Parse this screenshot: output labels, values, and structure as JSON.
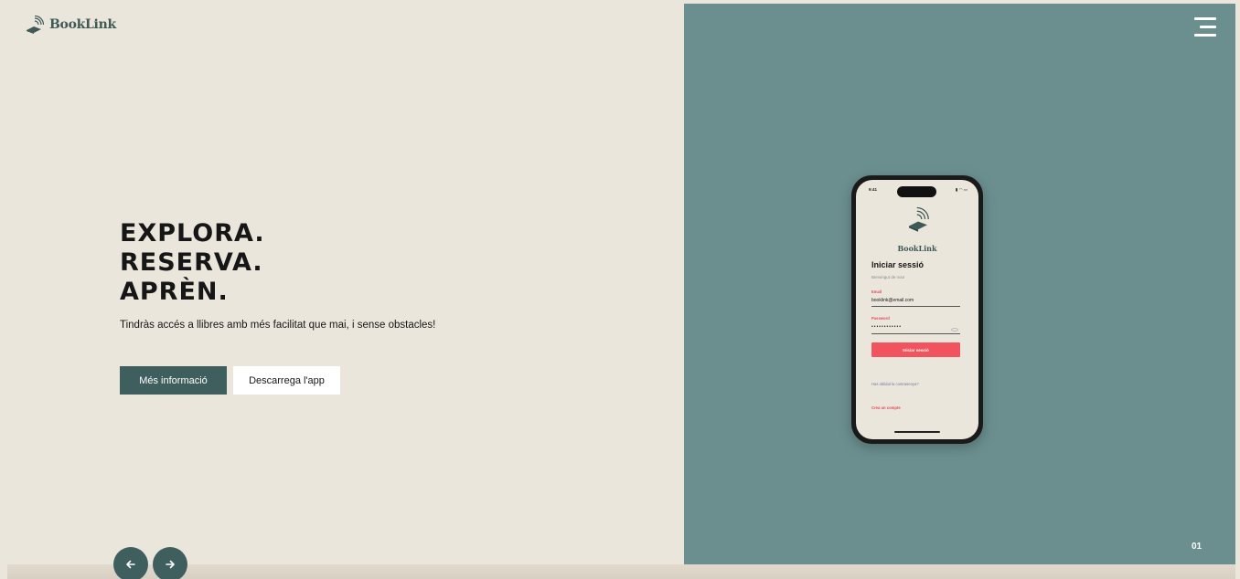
{
  "brand": {
    "name": "BookLink",
    "icon": "book-wifi-icon"
  },
  "header": {
    "menu_icon": "hamburger-menu-icon"
  },
  "hero": {
    "line1": "EXPLORA.",
    "line2": "RESERVA.",
    "line3": "APRÈN.",
    "subtitle": "Tindràs accés a llibres amb més facilitat que mai, i sense obstacles!",
    "primary_button": "Més informació",
    "secondary_button": "Descarrega l'app"
  },
  "carousel": {
    "prev_icon": "arrow-left-icon",
    "next_icon": "arrow-right-icon",
    "slide_number": "01"
  },
  "phone": {
    "time": "9:41",
    "brand": "BookLink",
    "title": "Iniciar sessió",
    "welcome": "Benvingut de nou!",
    "email_label": "Email",
    "email_value": "booklink@email.com",
    "password_label": "Password",
    "password_value": "••••••••••••",
    "submit": "Iniciar sessió",
    "forgot": "Has oblidat la contrasenya?",
    "create": "Crea un compte"
  },
  "colors": {
    "left_bg": "#ebe6dc",
    "right_bg": "#6b8f8f",
    "primary": "#3f5f5e",
    "accent": "#f2545f",
    "text": "#161616"
  }
}
